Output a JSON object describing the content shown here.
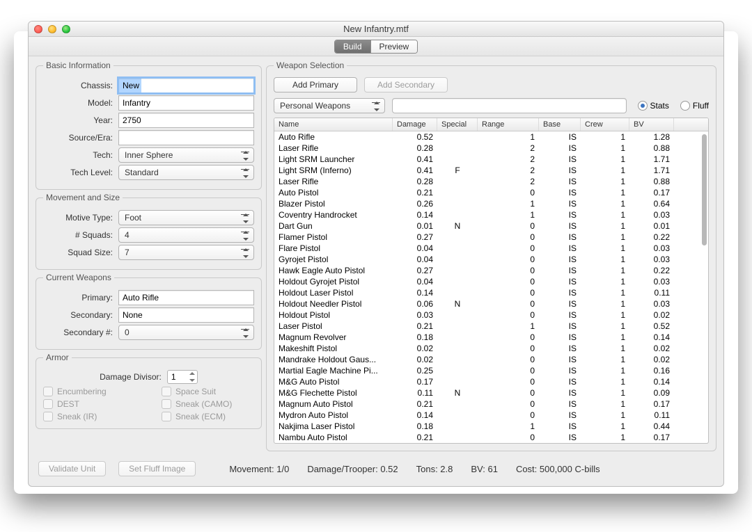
{
  "window": {
    "title": "New Infantry.mtf"
  },
  "tabs": {
    "build": "Build",
    "preview": "Preview",
    "active": "build"
  },
  "basic": {
    "legend": "Basic Information",
    "fields": {
      "chassis_label": "Chassis:",
      "chassis_value": "New",
      "model_label": "Model:",
      "model_value": "Infantry",
      "year_label": "Year:",
      "year_value": "2750",
      "source_label": "Source/Era:",
      "source_value": "",
      "tech_label": "Tech:",
      "tech_value": "Inner Sphere",
      "techlevel_label": "Tech Level:",
      "techlevel_value": "Standard"
    }
  },
  "movement": {
    "legend": "Movement and Size",
    "motive_label": "Motive Type:",
    "motive_value": "Foot",
    "squads_label": "# Squads:",
    "squads_value": "4",
    "squadsize_label": "Squad Size:",
    "squadsize_value": "7"
  },
  "current": {
    "legend": "Current Weapons",
    "primary_label": "Primary:",
    "primary_value": "Auto Rifle",
    "secondary_label": "Secondary:",
    "secondary_value": "None",
    "secnum_label": "Secondary #:",
    "secnum_value": "0"
  },
  "armor": {
    "legend": "Armor",
    "divisor_label": "Damage Divisor:",
    "divisor_value": "1",
    "encumbering": "Encumbering",
    "spacesuit": "Space Suit",
    "dest": "DEST",
    "sneak_camo": "Sneak (CAMO)",
    "sneak_ir": "Sneak (IR)",
    "sneak_ecm": "Sneak (ECM)"
  },
  "weapons": {
    "legend": "Weapon Selection",
    "add_primary": "Add Primary",
    "add_secondary": "Add Secondary",
    "category": "Personal Weapons",
    "stats_label": "Stats",
    "fluff_label": "Fluff",
    "columns": {
      "name": "Name",
      "damage": "Damage",
      "special": "Special",
      "range": "Range",
      "base": "Base",
      "crew": "Crew",
      "bv": "BV"
    },
    "rows": [
      {
        "name": "Auto Rifle",
        "damage": "0.52",
        "special": "",
        "range": "1",
        "base": "IS",
        "crew": "1",
        "bv": "1.28"
      },
      {
        "name": "Laser Rifle",
        "damage": "0.28",
        "special": "",
        "range": "2",
        "base": "IS",
        "crew": "1",
        "bv": "0.88"
      },
      {
        "name": "Light SRM Launcher",
        "damage": "0.41",
        "special": "",
        "range": "2",
        "base": "IS",
        "crew": "1",
        "bv": "1.71"
      },
      {
        "name": "Light SRM (Inferno)",
        "damage": "0.41",
        "special": "F",
        "range": "2",
        "base": "IS",
        "crew": "1",
        "bv": "1.71"
      },
      {
        "name": "Laser Rifle",
        "damage": "0.28",
        "special": "",
        "range": "2",
        "base": "IS",
        "crew": "1",
        "bv": "0.88"
      },
      {
        "name": "Auto Pistol",
        "damage": "0.21",
        "special": "",
        "range": "0",
        "base": "IS",
        "crew": "1",
        "bv": "0.17"
      },
      {
        "name": "Blazer Pistol",
        "damage": "0.26",
        "special": "",
        "range": "1",
        "base": "IS",
        "crew": "1",
        "bv": "0.64"
      },
      {
        "name": "Coventry Handrocket",
        "damage": "0.14",
        "special": "",
        "range": "1",
        "base": "IS",
        "crew": "1",
        "bv": "0.03"
      },
      {
        "name": "Dart Gun",
        "damage": "0.01",
        "special": "N",
        "range": "0",
        "base": "IS",
        "crew": "1",
        "bv": "0.01"
      },
      {
        "name": "Flamer Pistol",
        "damage": "0.27",
        "special": "",
        "range": "0",
        "base": "IS",
        "crew": "1",
        "bv": "0.22"
      },
      {
        "name": "Flare Pistol",
        "damage": "0.04",
        "special": "",
        "range": "0",
        "base": "IS",
        "crew": "1",
        "bv": "0.03"
      },
      {
        "name": "Gyrojet Pistol",
        "damage": "0.04",
        "special": "",
        "range": "0",
        "base": "IS",
        "crew": "1",
        "bv": "0.03"
      },
      {
        "name": "Hawk Eagle Auto Pistol",
        "damage": "0.27",
        "special": "",
        "range": "0",
        "base": "IS",
        "crew": "1",
        "bv": "0.22"
      },
      {
        "name": "Holdout Gyrojet Pistol",
        "damage": "0.04",
        "special": "",
        "range": "0",
        "base": "IS",
        "crew": "1",
        "bv": "0.03"
      },
      {
        "name": "Holdout Laser Pistol",
        "damage": "0.14",
        "special": "",
        "range": "0",
        "base": "IS",
        "crew": "1",
        "bv": "0.11"
      },
      {
        "name": "Holdout Needler Pistol",
        "damage": "0.06",
        "special": "N",
        "range": "0",
        "base": "IS",
        "crew": "1",
        "bv": "0.03"
      },
      {
        "name": "Holdout Pistol",
        "damage": "0.03",
        "special": "",
        "range": "0",
        "base": "IS",
        "crew": "1",
        "bv": "0.02"
      },
      {
        "name": "Laser Pistol",
        "damage": "0.21",
        "special": "",
        "range": "1",
        "base": "IS",
        "crew": "1",
        "bv": "0.52"
      },
      {
        "name": "Magnum Revolver",
        "damage": "0.18",
        "special": "",
        "range": "0",
        "base": "IS",
        "crew": "1",
        "bv": "0.14"
      },
      {
        "name": "Makeshift Pistol",
        "damage": "0.02",
        "special": "",
        "range": "0",
        "base": "IS",
        "crew": "1",
        "bv": "0.02"
      },
      {
        "name": "Mandrake Holdout Gaus...",
        "damage": "0.02",
        "special": "",
        "range": "0",
        "base": "IS",
        "crew": "1",
        "bv": "0.02"
      },
      {
        "name": "Martial Eagle Machine Pi...",
        "damage": "0.25",
        "special": "",
        "range": "0",
        "base": "IS",
        "crew": "1",
        "bv": "0.16"
      },
      {
        "name": "M&G Auto Pistol",
        "damage": "0.17",
        "special": "",
        "range": "0",
        "base": "IS",
        "crew": "1",
        "bv": "0.14"
      },
      {
        "name": "M&G Flechette Pistol",
        "damage": "0.11",
        "special": "N",
        "range": "0",
        "base": "IS",
        "crew": "1",
        "bv": "0.09"
      },
      {
        "name": "Magnum Auto Pistol",
        "damage": "0.21",
        "special": "",
        "range": "0",
        "base": "IS",
        "crew": "1",
        "bv": "0.17"
      },
      {
        "name": "Mydron Auto Pistol",
        "damage": "0.14",
        "special": "",
        "range": "0",
        "base": "IS",
        "crew": "1",
        "bv": "0.11"
      },
      {
        "name": "Nakjima Laser Pistol",
        "damage": "0.18",
        "special": "",
        "range": "1",
        "base": "IS",
        "crew": "1",
        "bv": "0.44"
      },
      {
        "name": "Nambu Auto Pistol",
        "damage": "0.21",
        "special": "",
        "range": "0",
        "base": "IS",
        "crew": "1",
        "bv": "0.17"
      }
    ]
  },
  "footer": {
    "validate": "Validate Unit",
    "fluffimg": "Set Fluff Image",
    "movement": "Movement: 1/0",
    "dpt": "Damage/Trooper: 0.52",
    "tons": "Tons: 2.8",
    "bv": "BV: 61",
    "cost": "Cost: 500,000 C-bills"
  }
}
